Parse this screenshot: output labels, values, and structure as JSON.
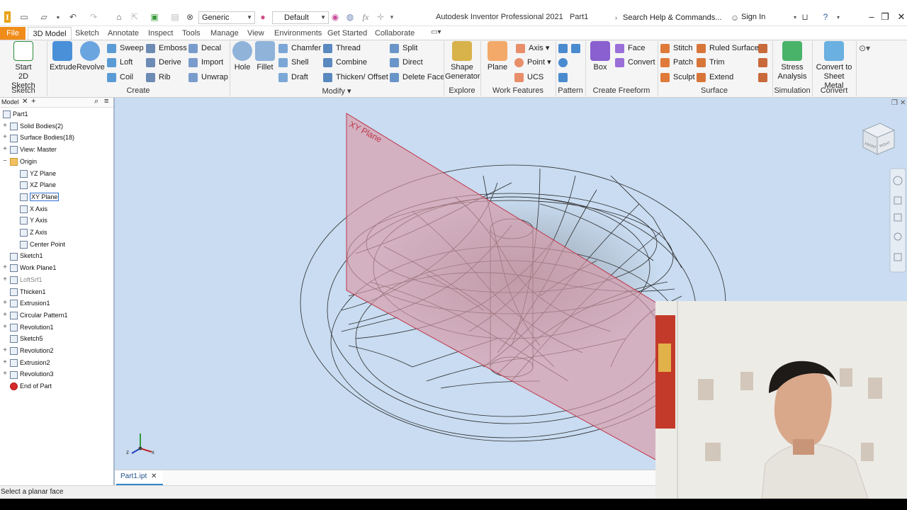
{
  "titlebar": {
    "app_title": "Autodesk Inventor Professional 2021",
    "document": "Part1",
    "appearance": "Generic",
    "style": "Default",
    "search_placeholder": "Search Help & Commands...",
    "sign_in": "Sign In"
  },
  "menu": {
    "file": "File",
    "active_tab": "3D Model",
    "tabs": [
      "Sketch",
      "Annotate",
      "Inspect",
      "Tools",
      "Manage",
      "View",
      "Environments",
      "Get Started",
      "Collaborate"
    ]
  },
  "ribbon": {
    "sketch_group": {
      "label": "Sketch",
      "start_sketch": "Start\n2D Sketch"
    },
    "create_group": {
      "label": "Create",
      "extrude": "Extrude",
      "revolve": "Revolve",
      "sweep": "Sweep",
      "loft": "Loft",
      "coil": "Coil",
      "emboss": "Emboss",
      "derive": "Derive",
      "rib": "Rib",
      "decal": "Decal",
      "import": "Import",
      "unwrap": "Unwrap"
    },
    "modify_group": {
      "label": "Modify",
      "hole": "Hole",
      "fillet": "Fillet",
      "chamfer": "Chamfer",
      "shell": "Shell",
      "draft": "Draft",
      "thread": "Thread",
      "combine": "Combine",
      "thicken": "Thicken/ Offset",
      "split": "Split",
      "direct": "Direct",
      "delete_face": "Delete Face"
    },
    "explore_group": {
      "label": "Explore",
      "shape_generator": "Shape\nGenerator"
    },
    "work_features_group": {
      "label": "Work Features",
      "plane": "Plane",
      "axis": "Axis",
      "point": "Point",
      "ucs": "UCS"
    },
    "pattern_group": {
      "label": "Pattern"
    },
    "freeform_group": {
      "label": "Create Freeform",
      "box": "Box",
      "face": "Face",
      "convert": "Convert"
    },
    "surface_group": {
      "label": "Surface",
      "stitch": "Stitch",
      "patch": "Patch",
      "sculpt": "Sculpt",
      "ruled_surface": "Ruled Surface",
      "trim": "Trim",
      "extend": "Extend"
    },
    "simulation_group": {
      "label": "Simulation",
      "stress": "Stress\nAnalysis"
    },
    "convert_group": {
      "label": "Convert",
      "sheet_metal": "Convert to\nSheet Metal"
    }
  },
  "browser": {
    "title": "Model",
    "items": [
      {
        "label": "Part1",
        "level": 0,
        "expander": ""
      },
      {
        "label": "Solid Bodies(2)",
        "level": 1,
        "expander": "+"
      },
      {
        "label": "Surface Bodies(18)",
        "level": 1,
        "expander": "+"
      },
      {
        "label": "View: Master",
        "level": 1,
        "expander": "+"
      },
      {
        "label": "Origin",
        "level": 1,
        "expander": "−"
      },
      {
        "label": "YZ Plane",
        "level": 2,
        "expander": ""
      },
      {
        "label": "XZ Plane",
        "level": 2,
        "expander": ""
      },
      {
        "label": "XY Plane",
        "level": 2,
        "expander": "",
        "selected": true
      },
      {
        "label": "X Axis",
        "level": 2,
        "expander": ""
      },
      {
        "label": "Y Axis",
        "level": 2,
        "expander": ""
      },
      {
        "label": "Z Axis",
        "level": 2,
        "expander": ""
      },
      {
        "label": "Center Point",
        "level": 2,
        "expander": ""
      },
      {
        "label": "Sketch1",
        "level": 1,
        "expander": ""
      },
      {
        "label": "Work Plane1",
        "level": 1,
        "expander": "+"
      },
      {
        "label": "LoftSrf1",
        "level": 1,
        "expander": "+"
      },
      {
        "label": "Thicken1",
        "level": 1,
        "expander": ""
      },
      {
        "label": "Extrusion1",
        "level": 1,
        "expander": "+"
      },
      {
        "label": "Circular Pattern1",
        "level": 1,
        "expander": "+"
      },
      {
        "label": "Revolution1",
        "level": 1,
        "expander": "+"
      },
      {
        "label": "Sketch5",
        "level": 1,
        "expander": ""
      },
      {
        "label": "Revolution2",
        "level": 1,
        "expander": "+"
      },
      {
        "label": "Extrusion2",
        "level": 1,
        "expander": "+"
      },
      {
        "label": "Revolution3",
        "level": 1,
        "expander": "+"
      },
      {
        "label": "End of Part",
        "level": 1,
        "expander": ""
      }
    ]
  },
  "viewport": {
    "plane_label": "XY Plane",
    "viewcube_front": "FRONT",
    "viewcube_right": "RIGHT",
    "triad_x": "x",
    "triad_z": "z"
  },
  "document_tab": {
    "label": "Part1.ipt"
  },
  "status": {
    "text": "Select a planar face"
  },
  "colors": {
    "file_tab": "#f08c1a",
    "plane_fill": "#d99aa8",
    "plane_edge": "#c0364a",
    "viewport_bg": "#c9dcf1"
  }
}
